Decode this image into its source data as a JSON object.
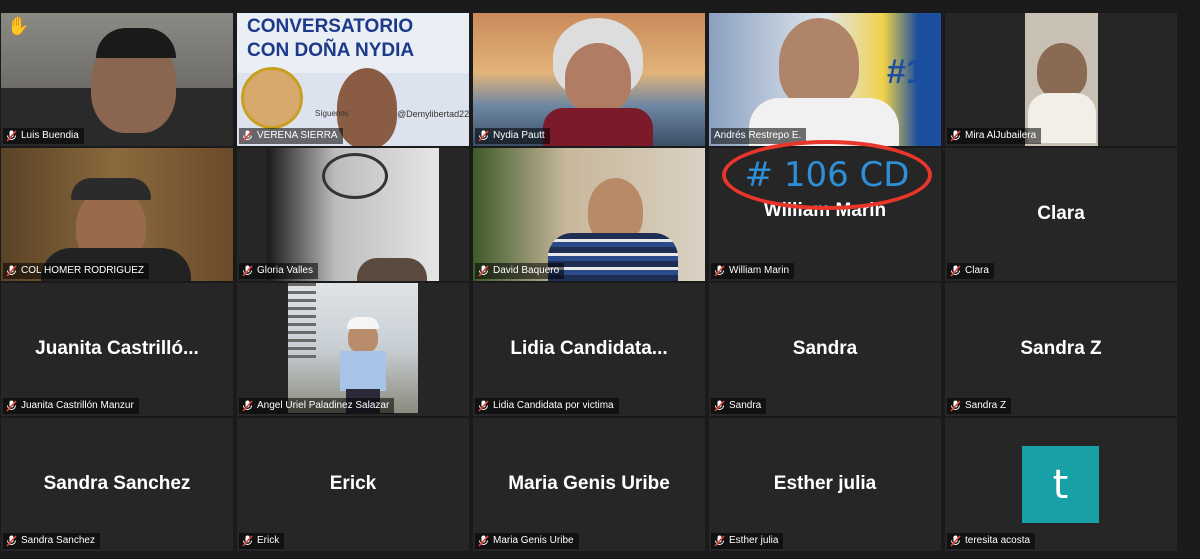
{
  "annotation": {
    "number_text": "# 106 CD"
  },
  "banner": {
    "line1": "CONVERSATORIO",
    "line2": "CON DOÑA NYDIA",
    "handle": "@Demylibertad22",
    "follow": "Síguenos"
  },
  "tiles": [
    {
      "name": "Luis Buendia",
      "big": "",
      "video": true,
      "hand": "✋"
    },
    {
      "name": "VERENA SIERRA",
      "big": "",
      "video": true
    },
    {
      "name": "Nydia Pautt",
      "big": "",
      "video": true
    },
    {
      "name": "Andrés Restrepo E.",
      "big": "",
      "video": true,
      "active": true
    },
    {
      "name": "Mira AlJubailera",
      "big": "",
      "video": true
    },
    {
      "name": "COL HOMER RODRIGUEZ",
      "big": "",
      "video": true
    },
    {
      "name": "Gloria Valles",
      "big": "",
      "video": true
    },
    {
      "name": "David Baquero",
      "big": "",
      "video": true
    },
    {
      "name": "William Marin",
      "big": "William Marin",
      "video": false
    },
    {
      "name": "Clara",
      "big": "Clara",
      "video": false
    },
    {
      "name": "Juanita Castrillón Manzur",
      "big": "Juanita  Castrilló...",
      "video": false
    },
    {
      "name": "Angel Uriel Paladinez Salazar",
      "big": "",
      "video": true
    },
    {
      "name": "Lidia Candidata por victima",
      "big": "Lidia  Candidata...",
      "video": false
    },
    {
      "name": "Sandra",
      "big": "Sandra",
      "video": false
    },
    {
      "name": "Sandra Z",
      "big": "Sandra Z",
      "video": false
    },
    {
      "name": "Sandra Sanchez",
      "big": "Sandra Sanchez",
      "video": false
    },
    {
      "name": "Erick",
      "big": "Erick",
      "video": false
    },
    {
      "name": "Maria Genis Uribe",
      "big": "Maria Genis Uribe",
      "video": false
    },
    {
      "name": "Esther julia",
      "big": "Esther julia",
      "video": false
    },
    {
      "name": "teresita acosta",
      "big": "",
      "video": false,
      "avatar": "t"
    }
  ],
  "colors": {
    "active_border": "#d6e06a",
    "annotation_red": "#e8362b",
    "annotation_blue": "#2e8fd6",
    "avatar_teal": "#17a0a6",
    "muted_icon": "#e0433a"
  }
}
